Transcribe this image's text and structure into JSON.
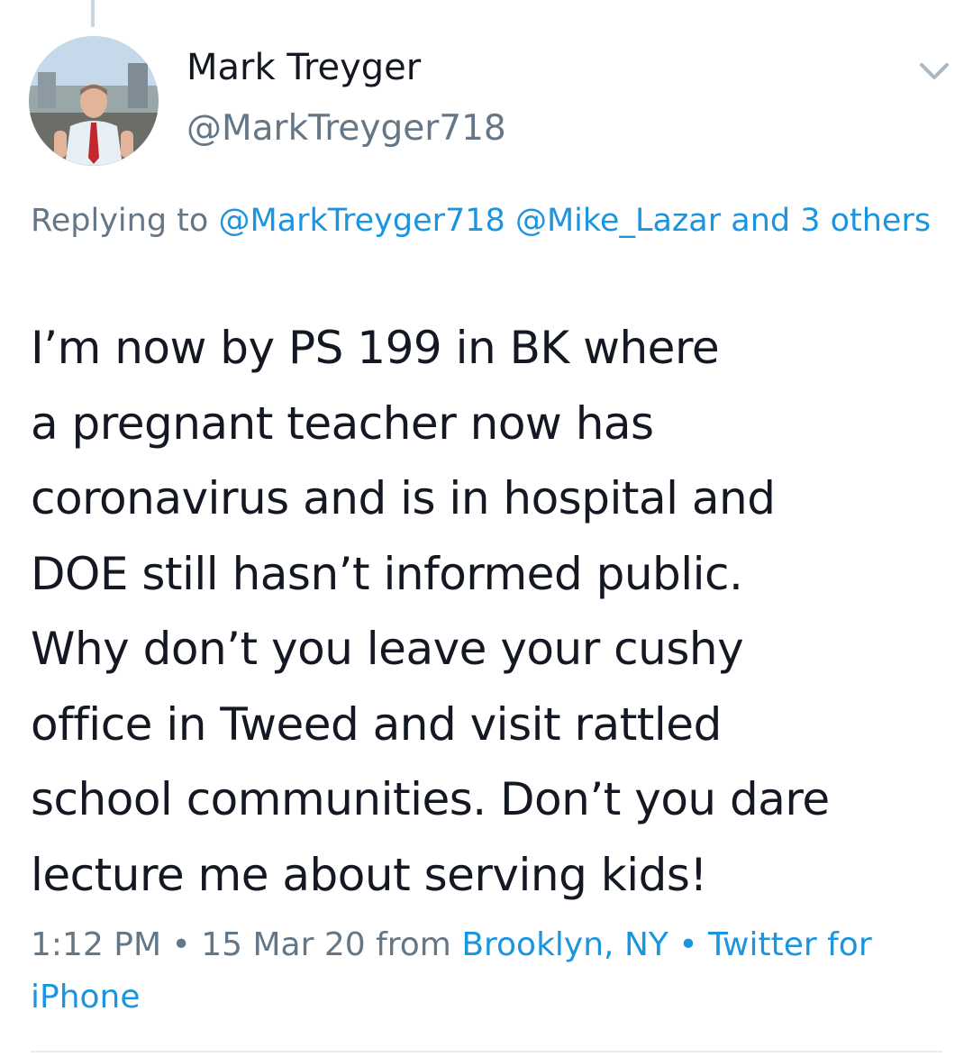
{
  "author": {
    "display_name": "Mark Treyger",
    "handle": "@MarkTreyger718",
    "avatar_icon": "profile-photo"
  },
  "reply": {
    "prefix": "Replying to",
    "mentions": [
      "@MarkTreyger718",
      "@Mike_Lazar"
    ],
    "others": "and 3 others"
  },
  "tweet": {
    "lines": [
      "I’m now by PS 199 in BK where",
      "a pregnant teacher now has",
      "coronavirus and is in hospital and",
      "DOE still hasn’t informed public.",
      "Why don’t you leave your cushy",
      "office in Tweed and visit rattled",
      "school communities. Don’t you dare",
      "lecture me about serving kids!"
    ]
  },
  "meta": {
    "time": "1:12 PM",
    "separator": "•",
    "date": "15 Mar 20",
    "from": "from",
    "location": "Brooklyn, NY",
    "source": "Twitter for iPhone"
  },
  "colors": {
    "link": "#1b95e0",
    "secondary": "#657786",
    "text": "#141823"
  },
  "icons": {
    "menu": "chevron-down-icon"
  }
}
